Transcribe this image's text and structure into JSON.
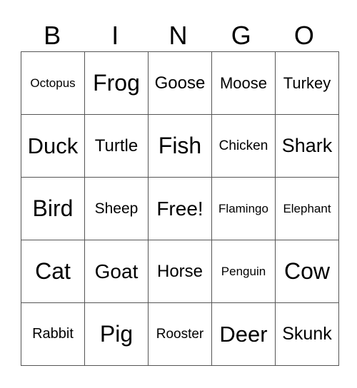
{
  "header": [
    "B",
    "I",
    "N",
    "G",
    "O"
  ],
  "rows": [
    [
      "Octopus",
      "Frog",
      "Goose",
      "Moose",
      "Turkey"
    ],
    [
      "Duck",
      "Turtle",
      "Fish",
      "Chicken",
      "Shark"
    ],
    [
      "Bird",
      "Sheep",
      "Free!",
      "Flamingo",
      "Elephant"
    ],
    [
      "Cat",
      "Goat",
      "Horse",
      "Penguin",
      "Cow"
    ],
    [
      "Rabbit",
      "Pig",
      "Rooster",
      "Deer",
      "Skunk"
    ]
  ]
}
